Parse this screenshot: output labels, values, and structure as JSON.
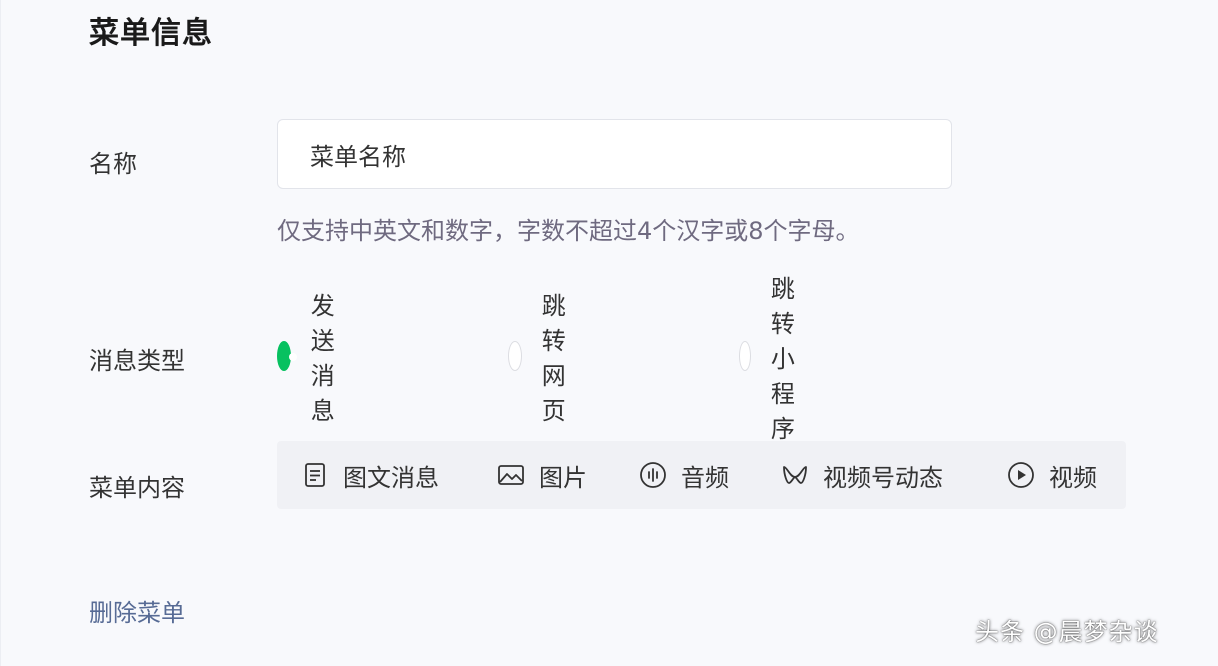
{
  "section_title": "菜单信息",
  "name_field": {
    "label": "名称",
    "value": "菜单名称",
    "hint": "仅支持中英文和数字，字数不超过4个汉字或8个字母。"
  },
  "message_type": {
    "label": "消息类型",
    "options": [
      {
        "label": "发送消息",
        "checked": true
      },
      {
        "label": "跳转网页",
        "checked": false
      },
      {
        "label": "跳转小程序",
        "checked": false
      }
    ]
  },
  "menu_content": {
    "label": "菜单内容",
    "tools": [
      {
        "label": "图文消息",
        "icon": "document-icon"
      },
      {
        "label": "图片",
        "icon": "image-icon"
      },
      {
        "label": "音频",
        "icon": "audio-icon"
      },
      {
        "label": "视频号动态",
        "icon": "channels-icon"
      },
      {
        "label": "视频",
        "icon": "play-icon"
      }
    ]
  },
  "delete_link": "删除菜单",
  "watermark": "头条 @晨梦杂谈",
  "colors": {
    "accent": "#07c160",
    "link": "#576b95"
  }
}
